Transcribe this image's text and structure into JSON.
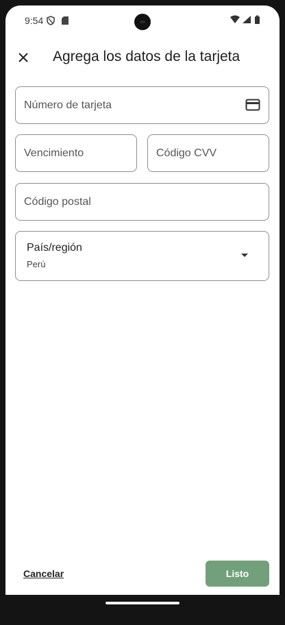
{
  "status_bar": {
    "time": "9:54"
  },
  "header": {
    "title": "Agrega los datos de la tarjeta",
    "close_icon": "close-icon"
  },
  "form": {
    "card_number": {
      "placeholder": "Número de tarjeta",
      "value": "",
      "icon": "credit-card-icon"
    },
    "expiry": {
      "placeholder": "Vencimiento",
      "value": ""
    },
    "cvv": {
      "placeholder": "Código CVV",
      "value": ""
    },
    "postal_code": {
      "placeholder": "Código postal",
      "value": ""
    },
    "country": {
      "label": "País/región",
      "value": "Perú",
      "icon": "dropdown-arrow-icon"
    }
  },
  "footer": {
    "cancel_label": "Cancelar",
    "done_label": "Listo"
  },
  "colors": {
    "primary_button": "#72a07a",
    "field_border": "#8e8e8e"
  }
}
